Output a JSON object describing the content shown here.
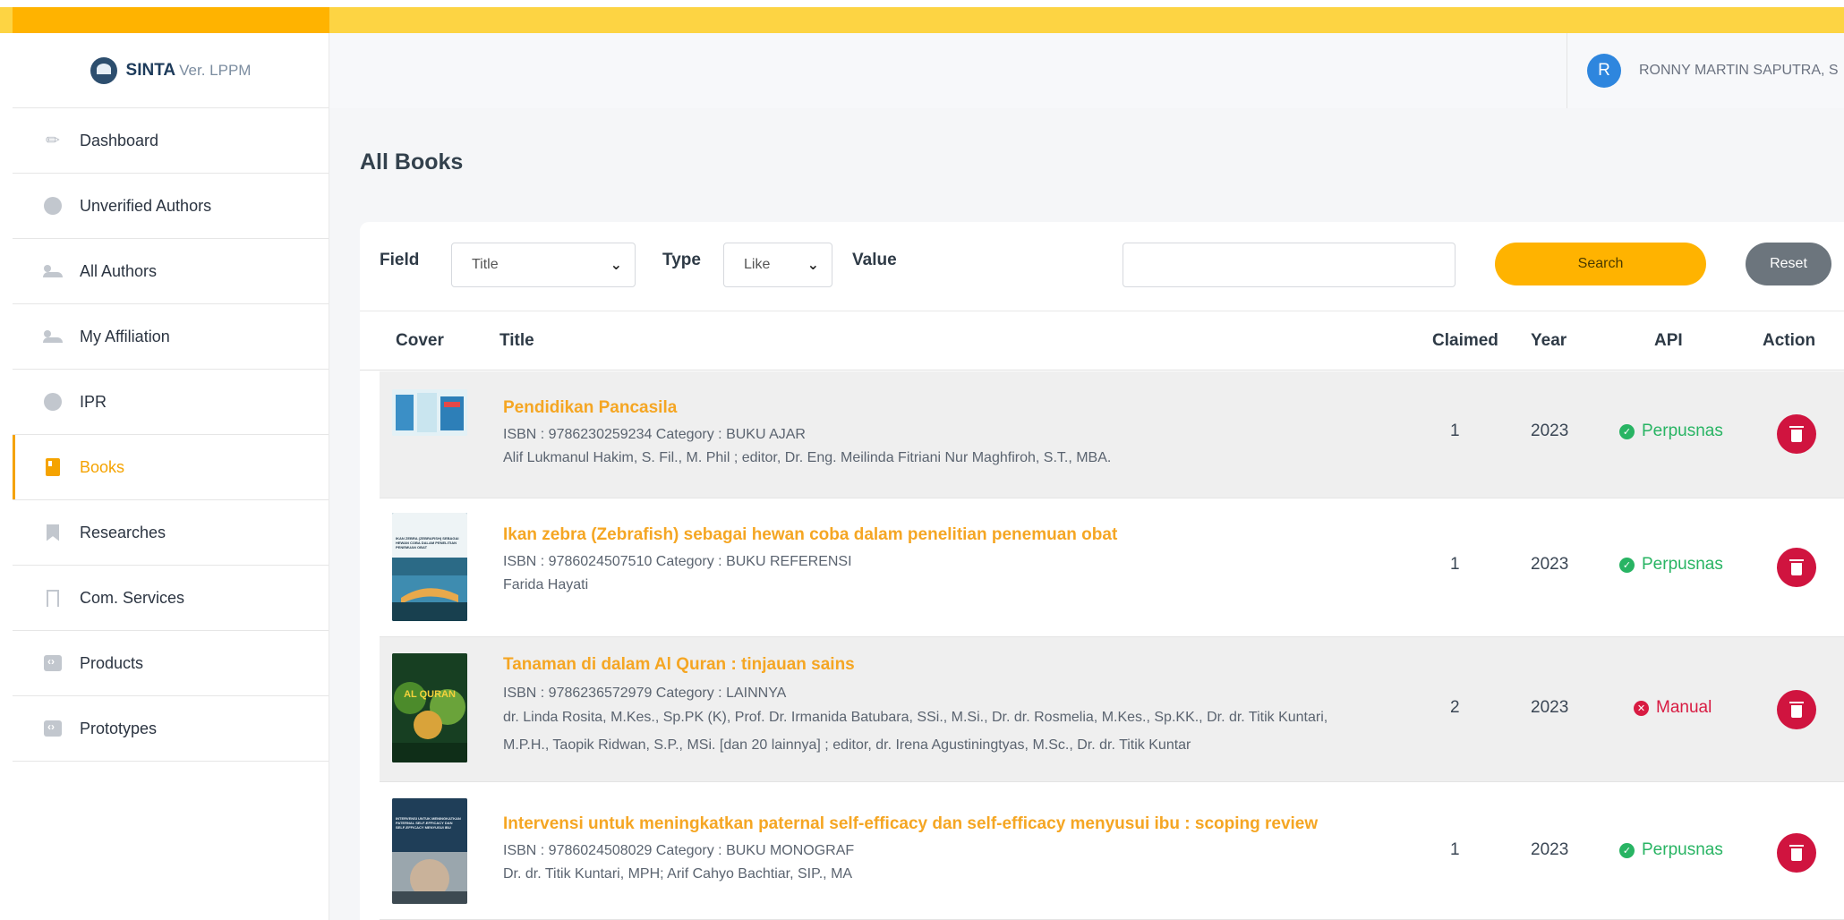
{
  "brand": {
    "name": "SINTA",
    "version": "Ver. LPPM"
  },
  "sidebar": {
    "items": [
      {
        "label": "Dashboard",
        "icon": "pencil-icon"
      },
      {
        "label": "Unverified Authors",
        "icon": "badge-icon"
      },
      {
        "label": "All Authors",
        "icon": "users-icon"
      },
      {
        "label": "My Affiliation",
        "icon": "users-icon"
      },
      {
        "label": "IPR",
        "icon": "badge-icon"
      },
      {
        "label": "Books",
        "icon": "book-icon",
        "active": true
      },
      {
        "label": "Researches",
        "icon": "bookmark-icon"
      },
      {
        "label": "Com. Services",
        "icon": "bookmark-outline-icon"
      },
      {
        "label": "Products",
        "icon": "code-box-icon"
      },
      {
        "label": "Prototypes",
        "icon": "code-box-icon"
      }
    ]
  },
  "header": {
    "user": {
      "initial": "R",
      "name": "RONNY MARTIN SAPUTRA, S"
    }
  },
  "page": {
    "title": "All Books"
  },
  "filter": {
    "field_label": "Field",
    "field_value": "Title",
    "type_label": "Type",
    "type_value": "Like",
    "value_label": "Value",
    "value_input": "",
    "search_label": "Search",
    "reset_label": "Reset"
  },
  "table": {
    "columns": {
      "cover": "Cover",
      "title": "Title",
      "claimed": "Claimed",
      "year": "Year",
      "api": "API",
      "action": "Action"
    },
    "rows": [
      {
        "title": "Pendidikan Pancasila",
        "meta": "ISBN : 9786230259234  Category : BUKU AJAR",
        "authors": "Alif Lukmanul Hakim, S. Fil., M. Phil ; editor, Dr. Eng. Meilinda Fitriani Nur Maghfiroh, S.T., MBA.",
        "authors2": "",
        "claimed": "1",
        "year": "2023",
        "api": "Perpusnas",
        "api_status": "ok"
      },
      {
        "title": "Ikan zebra (Zebrafish) sebagai hewan coba dalam penelitian penemuan obat",
        "meta": "ISBN : 9786024507510  Category : BUKU REFERENSI",
        "authors": "Farida Hayati",
        "authors2": "",
        "claimed": "1",
        "year": "2023",
        "api": "Perpusnas",
        "api_status": "ok"
      },
      {
        "title": "Tanaman di dalam Al Quran : tinjauan sains",
        "meta": "ISBN : 9786236572979  Category : LAINNYA",
        "authors": "dr. Linda Rosita, M.Kes., Sp.PK (K), Prof. Dr. Irmanida Batubara, SSi., M.Si., Dr. dr. Rosmelia, M.Kes., Sp.KK., Dr. dr. Titik Kuntari,",
        "authors2": "M.P.H., Taopik Ridwan, S.P., MSi. [dan 20 lainnya] ; editor, dr. Irena Agustiningtyas, M.Sc., Dr. dr. Titik Kuntar",
        "claimed": "2",
        "year": "2023",
        "api": "Manual",
        "api_status": "bad"
      },
      {
        "title": "Intervensi untuk meningkatkan paternal self-efficacy dan self-efficacy menyusui ibu : scoping review",
        "meta": "ISBN : 9786024508029  Category : BUKU MONOGRAF",
        "authors": "Dr. dr. Titik Kuntari, MPH; Arif Cahyo Bachtiar, SIP., MA",
        "authors2": "",
        "claimed": "1",
        "year": "2023",
        "api": "Perpusnas",
        "api_status": "ok"
      }
    ]
  },
  "cover_texts": {
    "row2": "IKAN ZEBRA (ZEBRAFISH) SEBAGAI HEWAN COBA DALAM PENELITIAN PENEMUAN OBAT",
    "row3": "AL QURAN",
    "row4": "INTERVENSI UNTUK MENINGKATKAN PATERNAL SELF-EFFICACY DAN SELF-EFFICACY MENYUSUI IBU"
  },
  "colors": {
    "accent": "#f5a300",
    "topbar": "#fdd443",
    "topbar_left": "#ffb300",
    "delete": "#d0143f",
    "ok": "#28b463",
    "bad": "#d81b42"
  }
}
